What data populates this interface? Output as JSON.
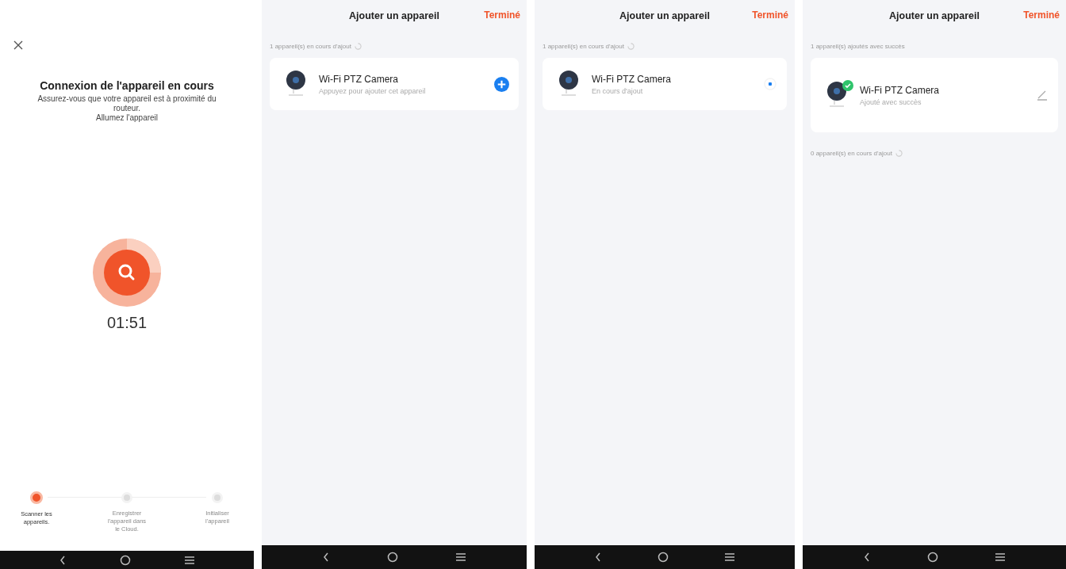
{
  "connect_screen": {
    "title": "Connexion de l'appareil en cours",
    "hint_lines": [
      "Assurez-vous que votre appareil est à proximité du",
      "routeur.",
      "Allumez l'appareil"
    ],
    "timer": "01:51",
    "steps": [
      {
        "label": "Scanner les appareils.",
        "selected": true
      },
      {
        "label": "Enregistrer l'appareil dans le Cloud.",
        "selected": false
      },
      {
        "label": "Initialiser l'appareil",
        "selected": false
      }
    ]
  },
  "add_screens": [
    {
      "title": "Ajouter un appareil",
      "done": "Terminé",
      "sections": [
        {
          "heading": "1 appareil(s) en cours d'ajout",
          "spinner": true,
          "devices": [
            {
              "name": "Wi-Fi PTZ Camera",
              "status": "Appuyez pour ajouter cet appareil",
              "kind": "add",
              "added": false
            }
          ]
        }
      ]
    },
    {
      "title": "Ajouter un appareil",
      "done": "Terminé",
      "sections": [
        {
          "heading": "1 appareil(s) en cours d'ajout",
          "spinner": true,
          "devices": [
            {
              "name": "Wi-Fi PTZ Camera",
              "status": "En cours d'ajout",
              "kind": "progress",
              "added": false
            }
          ]
        }
      ]
    },
    {
      "title": "Ajouter un appareil",
      "done": "Terminé",
      "sections": [
        {
          "heading": "1 appareil(s) ajoutés avec succès",
          "devices": [
            {
              "name": "Wi-Fi PTZ Camera",
              "status": "Ajouté avec succès",
              "kind": "edit",
              "added": true
            }
          ]
        },
        {
          "heading": "0 appareil(s) en cours d'ajout",
          "spinner": true
        }
      ]
    }
  ]
}
